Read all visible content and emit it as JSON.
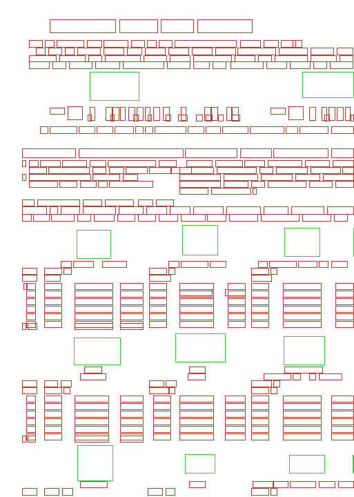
{
  "page": {
    "background": "#ffffff"
  },
  "colors": {
    "text_box": "#c0392b",
    "image_box": "#3cc83c"
  },
  "legend": {
    "text_box_meaning": "",
    "image_box_meaning": ""
  }
}
